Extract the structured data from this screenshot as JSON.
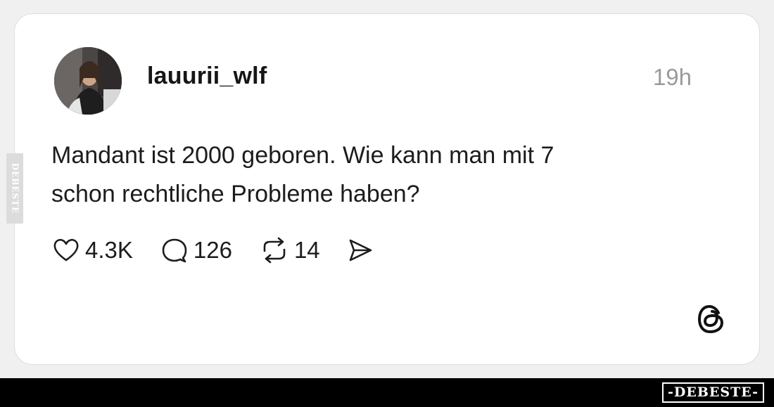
{
  "post": {
    "username": "lauurii_wlf",
    "timestamp": "19h",
    "text_line1": "Mandant ist 2000 geboren. Wie kann man mit 7",
    "text_line2": "schon rechtliche Probleme haben?",
    "likes": "4.3K",
    "replies": "126",
    "reposts": "14"
  },
  "icons": {
    "like": "heart-icon",
    "reply": "comment-bubble-icon",
    "repost": "repost-icon",
    "share": "send-icon",
    "app": "threads-logo-icon"
  },
  "watermark": {
    "side_text": "DEBESTE",
    "bottom_text": "-DEBESTE-"
  },
  "colors": {
    "background": "#f0f0f0",
    "card": "#ffffff",
    "text": "#1c1c1c",
    "muted": "#9a9a9a",
    "bar": "#000000"
  }
}
